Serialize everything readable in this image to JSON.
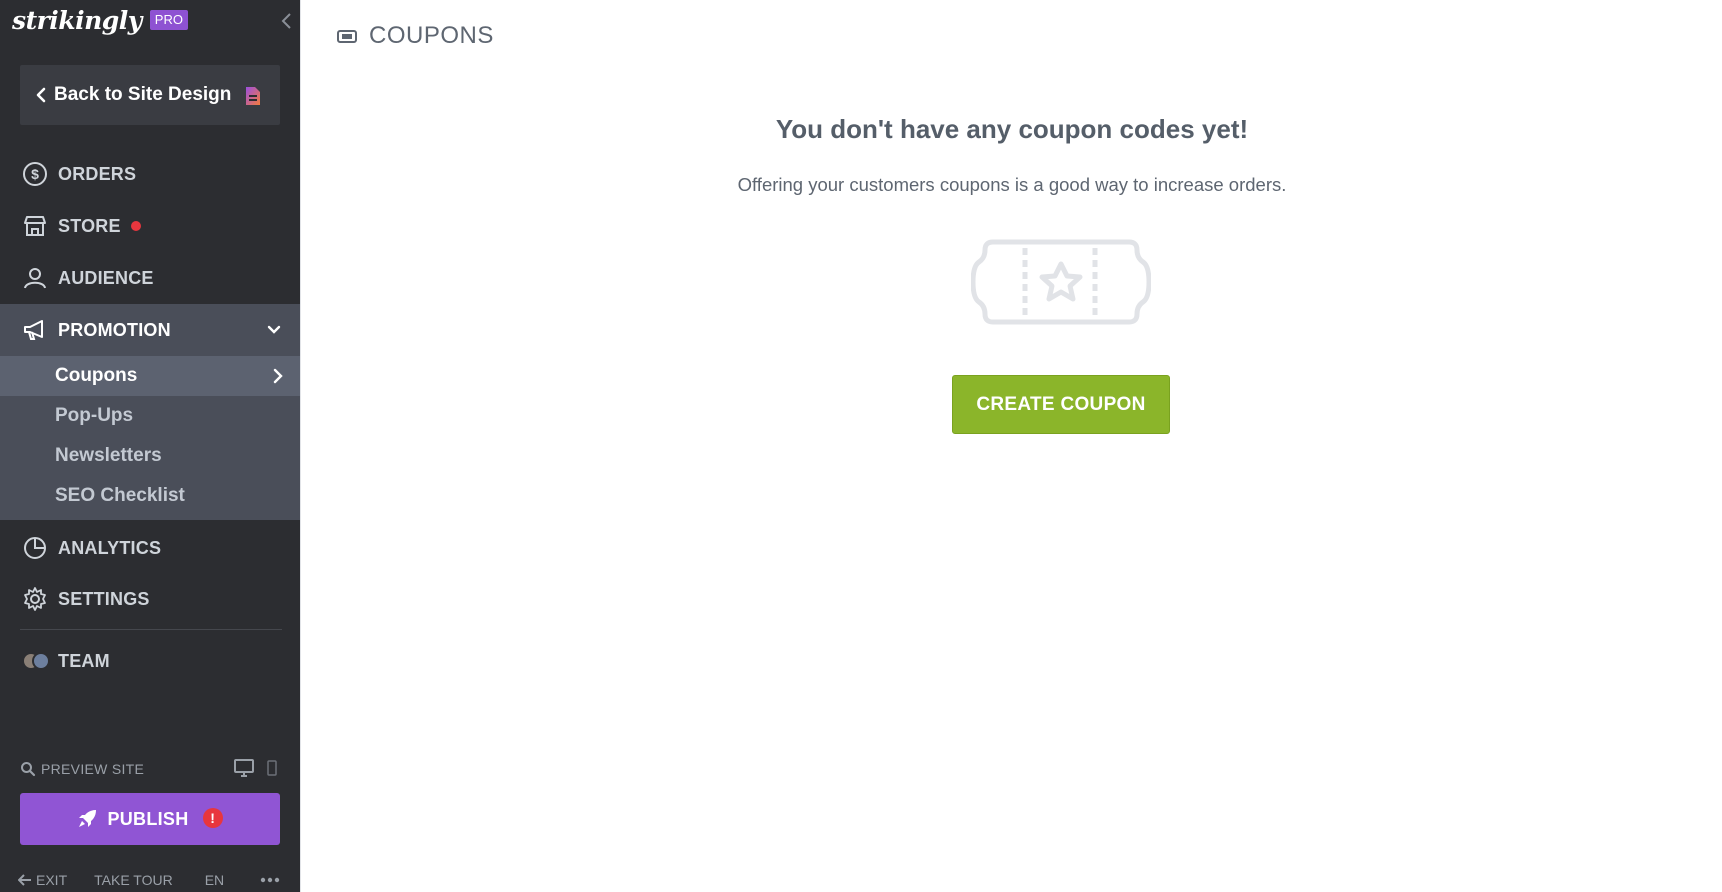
{
  "brand": {
    "name": "strikingly",
    "badge": "PRO"
  },
  "sidebar": {
    "back_label": "Back to Site Design",
    "nav": {
      "orders": "ORDERS",
      "store": "STORE",
      "audience": "AUDIENCE",
      "promotion": "PROMOTION",
      "analytics": "ANALYTICS",
      "settings": "SETTINGS",
      "team": "TEAM"
    },
    "promotion_sub": {
      "coupons": "Coupons",
      "popups": "Pop-Ups",
      "newsletters": "Newsletters",
      "seo": "SEO Checklist"
    },
    "preview_label": "PREVIEW SITE",
    "publish_label": "PUBLISH",
    "publish_alert": "!",
    "footer": {
      "exit": "EXIT",
      "tour": "TAKE TOUR",
      "lang": "EN"
    }
  },
  "main": {
    "title": "COUPONS",
    "empty_title": "You don't have any coupon codes yet!",
    "empty_subtitle": "Offering your customers coupons is a good way to increase orders.",
    "create_label": "CREATE COUPON"
  },
  "colors": {
    "sidebar_bg": "#2c2d31",
    "active_section": "#4a4e59",
    "active_item": "#5c6270",
    "publish": "#9055d4",
    "create": "#8bb52a",
    "alert": "#e8363e"
  },
  "icons": [
    "chevron-left-icon",
    "page-icon",
    "dollar-circle-icon",
    "storefront-icon",
    "user-icon",
    "megaphone-icon",
    "chevron-down-icon",
    "chevron-right-icon",
    "pie-chart-icon",
    "gear-icon",
    "search-icon",
    "desktop-icon",
    "mobile-icon",
    "rocket-icon",
    "arrow-left-icon",
    "more-dots-icon",
    "coupon-icon",
    "coupon-star-illustration"
  ]
}
